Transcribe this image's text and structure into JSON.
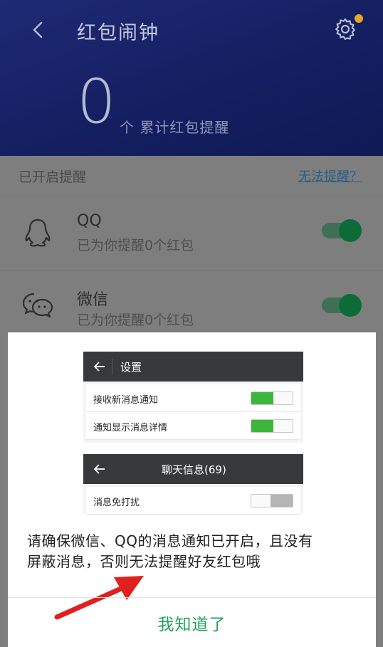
{
  "header": {
    "title": "红包闹钟",
    "count": "0",
    "count_label": "个 累计红包提醒"
  },
  "section": {
    "label": "已开启提醒",
    "help_link": "无法提醒？"
  },
  "apps": [
    {
      "name": "QQ",
      "subtitle": "已为你提醒0个红包",
      "enabled": true,
      "icon": "qq-penguin-icon"
    },
    {
      "name": "微信",
      "subtitle": "已为你提醒0个红包",
      "enabled": true,
      "icon": "wechat-bubbles-icon"
    }
  ],
  "dialog": {
    "mock_settings": {
      "title": "设置",
      "rows": [
        {
          "label": "接收新消息通知",
          "on": true
        },
        {
          "label": "通知显示消息详情",
          "on": true
        }
      ]
    },
    "mock_chat": {
      "title": "聊天信息(69)",
      "rows": [
        {
          "label": "消息免打扰",
          "on": false
        }
      ]
    },
    "notice_line1": "请确保微信、QQ的消息通知已开启，且没有",
    "notice_line2": "屏蔽消息，否则无法提醒好友红包哦",
    "confirm_label": "我知道了"
  },
  "colors": {
    "header_bg": "#2436a8",
    "toggle_on": "#0c6b37",
    "accent_green": "#25a05a",
    "link": "#2b5f86",
    "arrow": "#e0201f"
  }
}
